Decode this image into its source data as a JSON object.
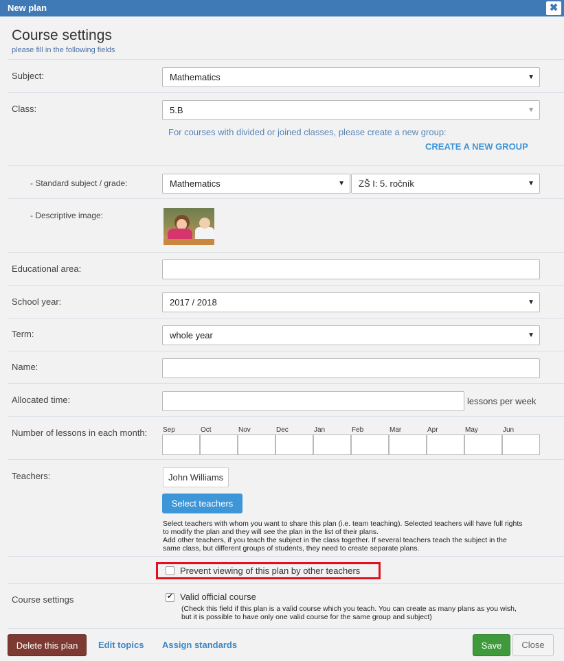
{
  "window": {
    "title": "New plan",
    "close_glyph": "✖"
  },
  "header": {
    "title": "Course settings",
    "subtitle": "please fill in the following fields"
  },
  "fields": {
    "subject": {
      "label": "Subject:",
      "value": "Mathematics"
    },
    "class": {
      "label": "Class:",
      "value": "5.B",
      "hint": "For courses with divided or joined classes, please create a new group:",
      "create_group": "CREATE A NEW GROUP"
    },
    "standard": {
      "label": "- Standard subject / grade:",
      "subject_value": "Mathematics",
      "grade_value": "ZŠ I: 5. ročník"
    },
    "image": {
      "label": "- Descriptive image:"
    },
    "educational_area": {
      "label": "Educational area:",
      "value": ""
    },
    "school_year": {
      "label": "School year:",
      "value": "2017 / 2018"
    },
    "term": {
      "label": "Term:",
      "value": "whole year"
    },
    "name": {
      "label": "Name:",
      "value": ""
    },
    "allocated_time": {
      "label": "Allocated time:",
      "value": "",
      "suffix": "lessons per week"
    },
    "lessons_per_month": {
      "label": "Number of lessons in each month:",
      "months": [
        "Sep",
        "Oct",
        "Nov",
        "Dec",
        "Jan",
        "Feb",
        "Mar",
        "Apr",
        "May",
        "Jun"
      ]
    },
    "teachers": {
      "label": "Teachers:",
      "selected": [
        "John Williams"
      ],
      "select_button": "Select teachers",
      "help_lines": [
        "Select teachers with whom you want to share this plan (i.e. team teaching). Selected teachers will have full rights",
        "to modify the plan and they will see the plan in the list of their plans.",
        "Add other teachers, if you teach the subject in the class together. If several teachers teach the subject in the",
        "same class, but different groups of students, they need to create separate plans."
      ]
    },
    "prevent_viewing": {
      "label": "Prevent viewing of this plan by other teachers",
      "checked": false
    },
    "course_settings": {
      "label": "Course settings",
      "valid_label": "Valid official course",
      "checked": true,
      "help_lines": [
        "(Check this field if this plan is a valid course which you teach. You can create as many plans as you wish,",
        "but it is possible to have only one valid course for the same group and subject)"
      ]
    }
  },
  "footer": {
    "delete": "Delete this plan",
    "edit_topics": "Edit topics",
    "assign_standards": "Assign standards",
    "save": "Save",
    "close": "Close"
  },
  "icons": {
    "dropdown_arrow": "▼",
    "checkmark": "✔"
  },
  "colors": {
    "titlebar": "#3f79b6",
    "primary": "#3d96d8",
    "danger": "#7d3a32",
    "success": "#3e9a3a",
    "highlight": "#e0101f"
  }
}
